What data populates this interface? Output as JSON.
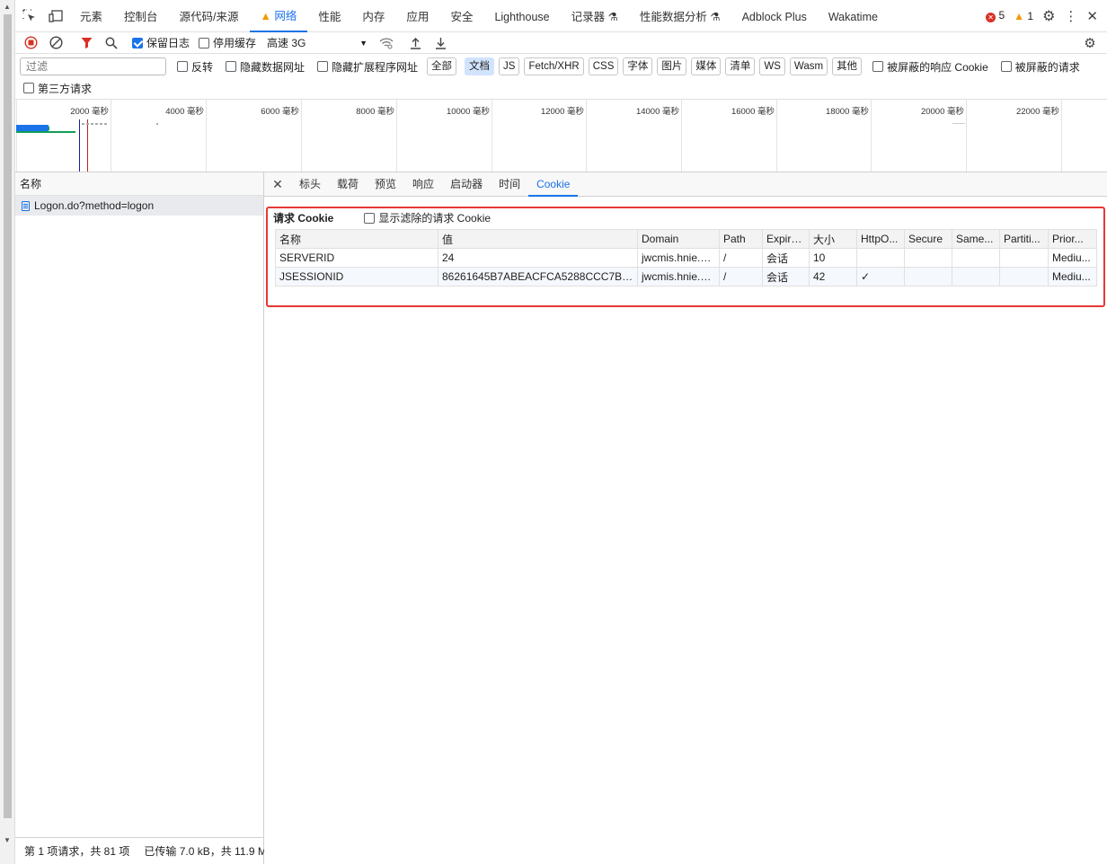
{
  "tabs": {
    "items": [
      {
        "label": "元素"
      },
      {
        "label": "控制台"
      },
      {
        "label": "源代码/来源"
      },
      {
        "label": "网络",
        "active": true
      },
      {
        "label": "性能"
      },
      {
        "label": "内存"
      },
      {
        "label": "应用"
      },
      {
        "label": "安全"
      },
      {
        "label": "Lighthouse"
      },
      {
        "label": "记录器"
      },
      {
        "label": "性能数据分析"
      },
      {
        "label": "Adblock Plus"
      },
      {
        "label": "Wakatime"
      }
    ],
    "errors": "5",
    "warnings": "1"
  },
  "toolbar": {
    "preserve_log": "保留日志",
    "disable_cache": "停用缓存",
    "throttle": "高速 3G"
  },
  "filter": {
    "placeholder": "过滤",
    "invert": "反转",
    "hide_data_urls": "隐藏数据网址",
    "hide_ext_urls": "隐藏扩展程序网址",
    "types": [
      "全部",
      "文档",
      "JS",
      "Fetch/XHR",
      "CSS",
      "字体",
      "图片",
      "媒体",
      "清单",
      "WS",
      "Wasm",
      "其他"
    ],
    "blocked_cookies": "被屏蔽的响应 Cookie",
    "blocked_requests": "被屏蔽的请求",
    "third_party": "第三方请求"
  },
  "timeline": {
    "ticks": [
      "2000 毫秒",
      "4000 毫秒",
      "6000 毫秒",
      "8000 毫秒",
      "10000 毫秒",
      "12000 毫秒",
      "14000 毫秒",
      "16000 毫秒",
      "18000 毫秒",
      "20000 毫秒",
      "22000 毫秒"
    ]
  },
  "requests": {
    "header": "名称",
    "items": [
      {
        "name": "Logon.do?method=logon"
      }
    ]
  },
  "status": {
    "requests": "第 1 项请求，共 81 项",
    "transferred": "已传输 7.0 kB，共 11.9 M"
  },
  "detail": {
    "tabs": [
      "标头",
      "载荷",
      "预览",
      "响应",
      "启动器",
      "时间",
      "Cookie"
    ],
    "section_title": "请求 Cookie",
    "show_filtered": "显示滤除的请求 Cookie",
    "columns": [
      "名称",
      "值",
      "Domain",
      "Path",
      "Expire...",
      "大小",
      "HttpO...",
      "Secure",
      "Same...",
      "Partiti...",
      "Prior..."
    ],
    "rows": [
      [
        "SERVERID",
        "24",
        "jwcmis.hnie.e...",
        "/",
        "会话",
        "10",
        "",
        "",
        "",
        "",
        "Mediu..."
      ],
      [
        "JSESSIONID",
        "86261645B7ABEACFCA5288CCC7B2B8...",
        "jwcmis.hnie.e...",
        "/",
        "会话",
        "42",
        "✓",
        "",
        "",
        "",
        "Mediu..."
      ]
    ]
  }
}
